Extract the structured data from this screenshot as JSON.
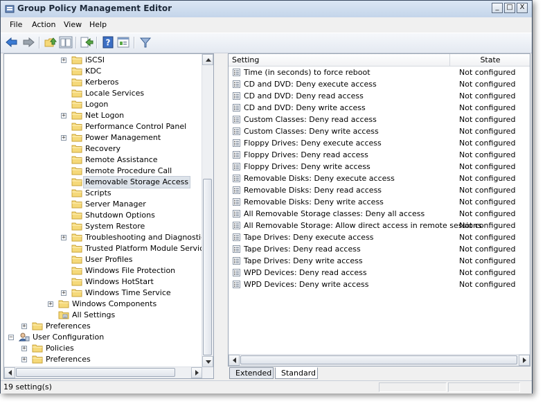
{
  "window": {
    "title": "Group Policy Management Editor",
    "minimize_label": "_",
    "maximize_label": "□",
    "close_label": "X"
  },
  "menu": {
    "items": [
      {
        "label": "File"
      },
      {
        "label": "Action"
      },
      {
        "label": "View"
      },
      {
        "label": "Help"
      }
    ]
  },
  "toolbar": {
    "icons": [
      "back-icon",
      "forward-icon",
      "up-folder-icon",
      "show-hide-tree-icon",
      "export-list-icon",
      "help-icon",
      "properties-icon",
      "filter-icon"
    ]
  },
  "tree": {
    "items": [
      {
        "label": "iSCSI",
        "level": 4,
        "expandable": true,
        "expander": "+"
      },
      {
        "label": "KDC",
        "level": 4,
        "expandable": false
      },
      {
        "label": "Kerberos",
        "level": 4,
        "expandable": false
      },
      {
        "label": "Locale Services",
        "level": 4,
        "expandable": false
      },
      {
        "label": "Logon",
        "level": 4,
        "expandable": false
      },
      {
        "label": "Net Logon",
        "level": 4,
        "expandable": true,
        "expander": "+"
      },
      {
        "label": "Performance Control Panel",
        "level": 4,
        "expandable": false
      },
      {
        "label": "Power Management",
        "level": 4,
        "expandable": true,
        "expander": "+"
      },
      {
        "label": "Recovery",
        "level": 4,
        "expandable": false
      },
      {
        "label": "Remote Assistance",
        "level": 4,
        "expandable": false
      },
      {
        "label": "Remote Procedure Call",
        "level": 4,
        "expandable": false
      },
      {
        "label": "Removable Storage Access",
        "level": 4,
        "expandable": false,
        "selected": true
      },
      {
        "label": "Scripts",
        "level": 4,
        "expandable": false
      },
      {
        "label": "Server Manager",
        "level": 4,
        "expandable": false
      },
      {
        "label": "Shutdown Options",
        "level": 4,
        "expandable": false
      },
      {
        "label": "System Restore",
        "level": 4,
        "expandable": false
      },
      {
        "label": "Troubleshooting and Diagnostics",
        "level": 4,
        "expandable": true,
        "expander": "+"
      },
      {
        "label": "Trusted Platform Module Services",
        "level": 4,
        "expandable": false
      },
      {
        "label": "User Profiles",
        "level": 4,
        "expandable": false
      },
      {
        "label": "Windows File Protection",
        "level": 4,
        "expandable": false
      },
      {
        "label": "Windows HotStart",
        "level": 4,
        "expandable": false
      },
      {
        "label": "Windows Time Service",
        "level": 4,
        "expandable": true,
        "expander": "+"
      },
      {
        "label": "Windows Components",
        "level": 3,
        "expandable": true,
        "expander": "+"
      },
      {
        "label": "All Settings",
        "level": 3,
        "expandable": false,
        "icon": "settings"
      },
      {
        "label": "Preferences",
        "level": 1,
        "expandable": true,
        "expander": "+"
      },
      {
        "label": "User Configuration",
        "level": 0,
        "expandable": true,
        "expander": "−",
        "icon": "user"
      },
      {
        "label": "Policies",
        "level": 1,
        "expandable": true,
        "expander": "+"
      },
      {
        "label": "Preferences",
        "level": 1,
        "expandable": true,
        "expander": "+"
      }
    ]
  },
  "list": {
    "columns": {
      "setting": "Setting",
      "state": "State"
    },
    "rows": [
      {
        "setting": "Time (in seconds) to force reboot",
        "state": "Not configured"
      },
      {
        "setting": "CD and DVD: Deny execute access",
        "state": "Not configured"
      },
      {
        "setting": "CD and DVD: Deny read access",
        "state": "Not configured"
      },
      {
        "setting": "CD and DVD: Deny write access",
        "state": "Not configured"
      },
      {
        "setting": "Custom Classes: Deny read access",
        "state": "Not configured"
      },
      {
        "setting": "Custom Classes: Deny write access",
        "state": "Not configured"
      },
      {
        "setting": "Floppy Drives: Deny execute access",
        "state": "Not configured"
      },
      {
        "setting": "Floppy Drives: Deny read access",
        "state": "Not configured"
      },
      {
        "setting": "Floppy Drives: Deny write access",
        "state": "Not configured"
      },
      {
        "setting": "Removable Disks: Deny execute access",
        "state": "Not configured"
      },
      {
        "setting": "Removable Disks: Deny read access",
        "state": "Not configured"
      },
      {
        "setting": "Removable Disks: Deny write access",
        "state": "Not configured"
      },
      {
        "setting": "All Removable Storage classes: Deny all access",
        "state": "Not configured"
      },
      {
        "setting": "All Removable Storage: Allow direct access in remote sessions",
        "state": "Not configured"
      },
      {
        "setting": "Tape Drives: Deny execute access",
        "state": "Not configured"
      },
      {
        "setting": "Tape Drives: Deny read access",
        "state": "Not configured"
      },
      {
        "setting": "Tape Drives: Deny write access",
        "state": "Not configured"
      },
      {
        "setting": "WPD Devices: Deny read access",
        "state": "Not configured"
      },
      {
        "setting": "WPD Devices: Deny write access",
        "state": "Not configured"
      }
    ]
  },
  "tabs": [
    {
      "label": "Extended",
      "active": false
    },
    {
      "label": "Standard",
      "active": true
    }
  ],
  "status": {
    "text": "19 setting(s)"
  },
  "colors": {
    "folder": "#f5d97a",
    "folder_edge": "#c9a236",
    "selection": "#dde3ea"
  }
}
